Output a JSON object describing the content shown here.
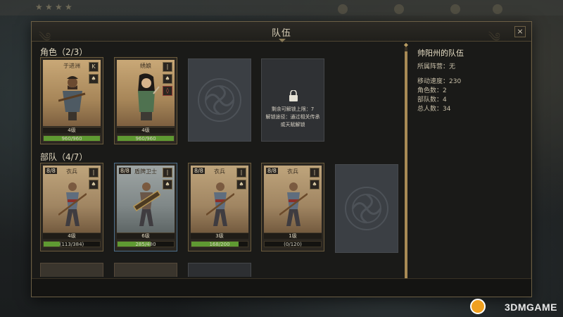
{
  "window": {
    "title": "队伍",
    "close_label": "×"
  },
  "characters": {
    "section_title": "角色（2/3）",
    "cards": [
      {
        "name": "于进洲",
        "level": "4级",
        "exp": "960/960",
        "exp_fraction": 1.0,
        "role": "K"
      },
      {
        "name": "绣娘",
        "level": "4级",
        "exp": "960/960",
        "exp_fraction": 1.0,
        "role": "|"
      }
    ],
    "locked": {
      "line1": "剩余可解锁上限：7",
      "line2": "解锁途径：通过相关传承",
      "line3": "或天赋解锁"
    }
  },
  "troops": {
    "section_title": "部队（4/7）",
    "cards": [
      {
        "count": "8/8",
        "name": "衣兵",
        "level": "4级",
        "exp": "(113/384)",
        "exp_fraction": 0.29
      },
      {
        "count": "8/8",
        "name": "盾牌卫士",
        "level": "6级",
        "exp": "285/480",
        "exp_fraction": 0.59
      },
      {
        "count": "8/8",
        "name": "衣兵",
        "level": "3级",
        "exp": "168/200",
        "exp_fraction": 0.84
      },
      {
        "count": "8/8",
        "name": "衣兵",
        "level": "1级",
        "exp": "(0/120)",
        "exp_fraction": 0.0
      }
    ]
  },
  "info": {
    "title": "帅阳州的队伍",
    "faction": "所属阵营：无",
    "speed": "移动速度：230",
    "characters": "角色数：2",
    "troops": "部队数：4",
    "total": "总人数：34"
  },
  "watermark": {
    "text": "3DMGAME"
  },
  "colors": {
    "panel_bg": "#1a1a18",
    "border_gold": "#6c5f45",
    "exp_green": "#5f9a32",
    "card_blue": "#4c6f8c"
  }
}
